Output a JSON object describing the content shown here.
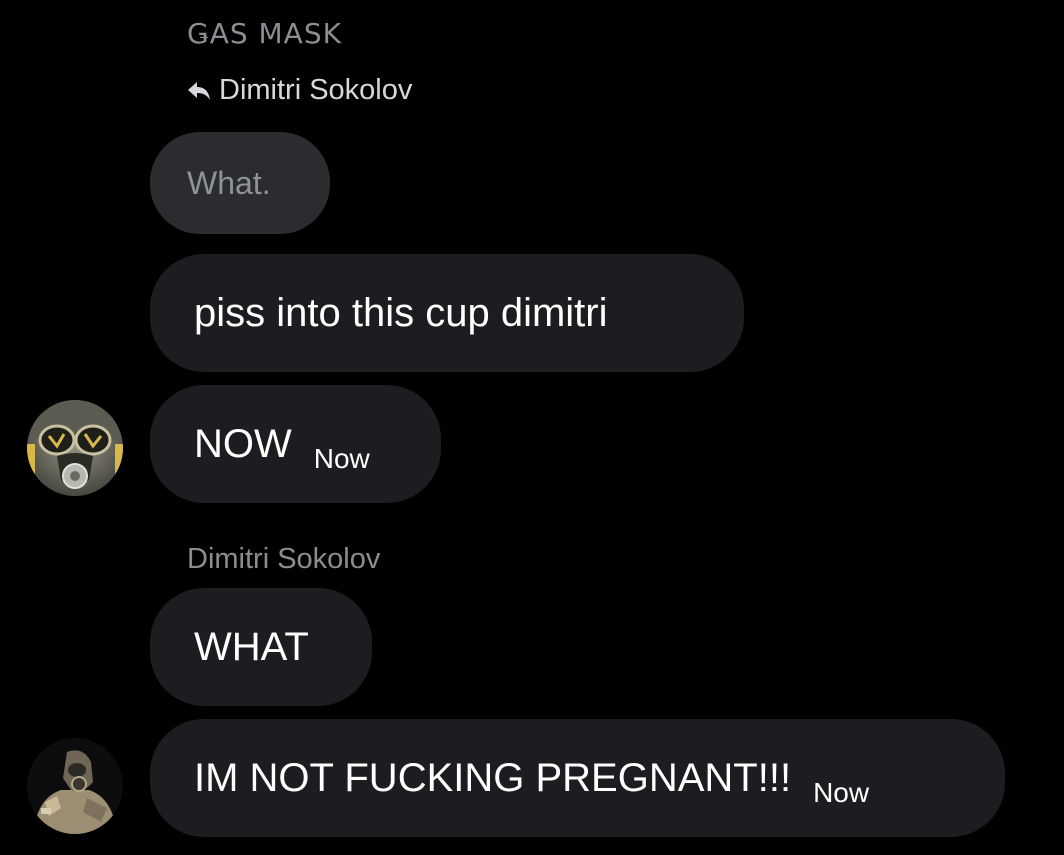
{
  "thread": {
    "first_sender": "ǤAS MASK",
    "reply_to": "Dimitri Sokolov",
    "quoted_text": "What.",
    "second_sender": "Dimitri Sokolov"
  },
  "messages": [
    {
      "text": "piss into this cup dimitri",
      "time": ""
    },
    {
      "text": "NOW",
      "time": "Now"
    },
    {
      "text": "WHAT",
      "time": ""
    },
    {
      "text": "IM NOT FUCKING PREGNANT!!!",
      "time": "Now"
    }
  ],
  "icons": {
    "reply": "reply-arrow-icon",
    "avatar_1": "gas-mask-avatar",
    "avatar_2": "hazmat-figure-avatar"
  },
  "colors": {
    "background": "#000000",
    "bubble": "#1c1d20",
    "quoted_bubble": "#2a2c30",
    "muted_text": "#8a8d91",
    "text": "#ffffff"
  }
}
